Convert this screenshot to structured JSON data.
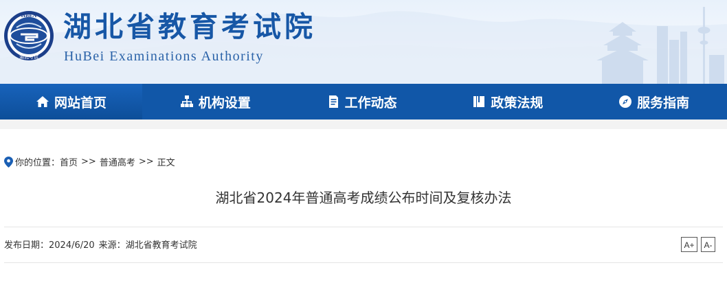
{
  "header": {
    "logo_text": "HBEA 湖北考试",
    "title": "湖北省教育考试院",
    "subtitle": "HuBei Examinations Authority"
  },
  "nav": {
    "items": [
      {
        "label": "网站首页",
        "icon": "home-icon",
        "active": true
      },
      {
        "label": "机构设置",
        "icon": "org-chart-icon",
        "active": false
      },
      {
        "label": "工作动态",
        "icon": "document-icon",
        "active": false
      },
      {
        "label": "政策法规",
        "icon": "book-icon",
        "active": false
      },
      {
        "label": "服务指南",
        "icon": "compass-icon",
        "active": false
      }
    ]
  },
  "breadcrumb": {
    "prefix": "你的位置：",
    "items": [
      "首页",
      "普通高考",
      "正文"
    ],
    "separator": ">>"
  },
  "article": {
    "title": "湖北省2024年普通高考成绩公布时间及复核办法",
    "date_label": "发布日期：2024/6/20",
    "source_label": "来源：湖北省教育考试院"
  },
  "font_controls": {
    "increase": "A+",
    "decrease": "A-"
  },
  "colors": {
    "nav_bg": "#1157a8",
    "brand_blue": "#1757a6",
    "pin_blue": "#1a5fb4"
  }
}
